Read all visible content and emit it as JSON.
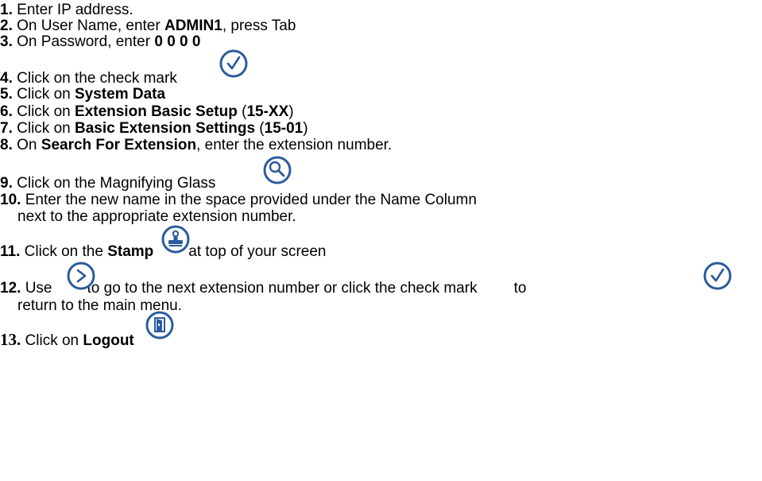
{
  "colors": {
    "text": "#000000",
    "icon_stroke": "#2a5b9c"
  },
  "steps": [
    {
      "num": "1.",
      "parts": [
        "Enter IP address."
      ]
    },
    {
      "num": "2.",
      "parts": [
        "On User Name, enter ",
        "ADMIN1",
        ", press Tab"
      ]
    },
    {
      "num": "3.",
      "parts": [
        "On Password, enter ",
        "0 0 0 0"
      ]
    },
    {
      "num": "4.",
      "parts": [
        "Click on the check mark"
      ]
    },
    {
      "num": "5.",
      "parts": [
        "Click on ",
        "System Data"
      ]
    },
    {
      "num": "6.",
      "parts": [
        "Click on ",
        "Extension Basic Setup",
        " (",
        "15-XX",
        ")"
      ]
    },
    {
      "num": "7.",
      "parts": [
        "Click on ",
        "Basic Extension Settings",
        " (",
        "15-01",
        ")"
      ]
    },
    {
      "num": "8.",
      "parts": [
        "On ",
        "Search For Extension",
        ", enter the extension number."
      ]
    },
    {
      "num": "9.",
      "parts": [
        "Click on the Magnifying Glass"
      ]
    },
    {
      "num": "10.",
      "parts": [
        "Enter the new name in the space provided under the Name Column"
      ],
      "continuation": "next to the appropriate extension number."
    },
    {
      "num": "11.",
      "parts": [
        "Click on the ",
        "Stamp",
        "at top of your screen"
      ]
    },
    {
      "num": "12.",
      "parts": [
        "Use",
        "to go to the next extension number or click the check mark",
        "to"
      ],
      "continuation": "return to the main menu."
    },
    {
      "num": "13.",
      "parts": [
        "Click on ",
        "Logout"
      ]
    }
  ],
  "icons": {
    "check": "check-circle-icon",
    "magnifier": "magnifying-glass-icon",
    "stamp": "stamp-icon",
    "next": "next-arrow-icon",
    "logout": "logout-door-icon"
  }
}
